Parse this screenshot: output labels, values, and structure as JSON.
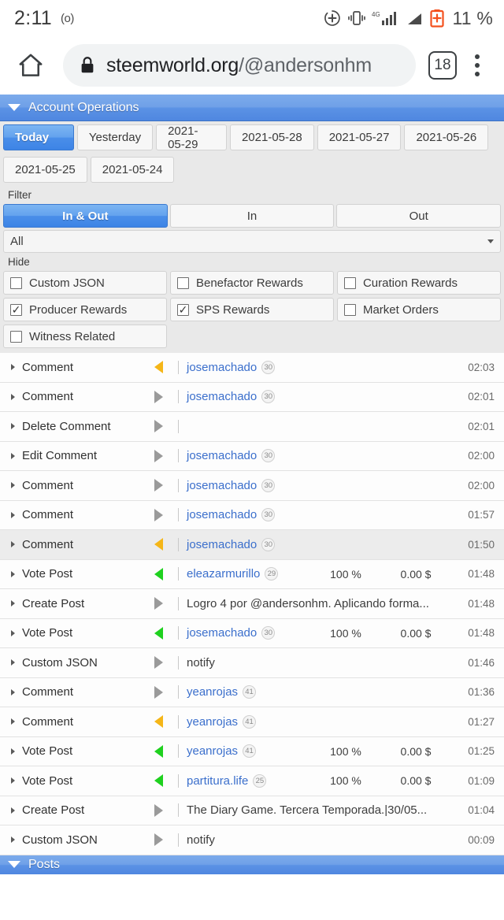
{
  "status_bar": {
    "clock": "2:11",
    "alarm_icon": "alarm-ring-icon",
    "alarm_glyph": "(o)",
    "icons": [
      "data-saver-icon",
      "vibrate-icon",
      "signal-4g-icon",
      "no-sim-icon",
      "battery-charging-icon"
    ],
    "battery_percent": "11 %",
    "network_label": "4G"
  },
  "browser": {
    "home_icon": "home-icon",
    "lock_icon": "lock-icon",
    "url_host": "steemworld.org",
    "url_path": "/@andersonhm",
    "tab_count": "18",
    "menu_icon": "overflow-menu-icon"
  },
  "panel": {
    "title": "Account Operations",
    "caret_icon": "chevron-down-icon"
  },
  "date_tabs": [
    {
      "label": "Today",
      "active": true
    },
    {
      "label": "Yesterday",
      "active": false
    },
    {
      "label": "2021-05-29",
      "active": false
    },
    {
      "label": "2021-05-28",
      "active": false
    },
    {
      "label": "2021-05-27",
      "active": false
    },
    {
      "label": "2021-05-26",
      "active": false
    },
    {
      "label": "2021-05-25",
      "active": false
    },
    {
      "label": "2021-05-24",
      "active": false
    }
  ],
  "filter": {
    "label": "Filter",
    "segments": [
      {
        "label": "In & Out",
        "active": true
      },
      {
        "label": "In",
        "active": false
      },
      {
        "label": "Out",
        "active": false
      }
    ],
    "select_value": "All",
    "select_caret": "caret-down-icon"
  },
  "hide": {
    "label": "Hide",
    "options": [
      {
        "label": "Custom JSON",
        "checked": false
      },
      {
        "label": "Benefactor Rewards",
        "checked": false
      },
      {
        "label": "Curation Rewards",
        "checked": false
      },
      {
        "label": "Producer Rewards",
        "checked": true
      },
      {
        "label": "SPS Rewards",
        "checked": true
      },
      {
        "label": "Market Orders",
        "checked": false
      },
      {
        "label": "Witness Related",
        "checked": false
      }
    ],
    "check_glyph": "✓"
  },
  "operations": [
    {
      "type": "Comment",
      "dir": "in",
      "color": "orange",
      "account": "josemachado",
      "rep": "30",
      "memo": "",
      "pct": "",
      "amount": "",
      "time": "02:03",
      "alt": false
    },
    {
      "type": "Comment",
      "dir": "out",
      "color": "gray",
      "account": "josemachado",
      "rep": "30",
      "memo": "",
      "pct": "",
      "amount": "",
      "time": "02:01",
      "alt": false
    },
    {
      "type": "Delete Comment",
      "dir": "out",
      "color": "gray",
      "account": "",
      "rep": "",
      "memo": "",
      "pct": "",
      "amount": "",
      "time": "02:01",
      "alt": false
    },
    {
      "type": "Edit Comment",
      "dir": "out",
      "color": "gray",
      "account": "josemachado",
      "rep": "30",
      "memo": "",
      "pct": "",
      "amount": "",
      "time": "02:00",
      "alt": false
    },
    {
      "type": "Comment",
      "dir": "out",
      "color": "gray",
      "account": "josemachado",
      "rep": "30",
      "memo": "",
      "pct": "",
      "amount": "",
      "time": "02:00",
      "alt": false
    },
    {
      "type": "Comment",
      "dir": "out",
      "color": "gray",
      "account": "josemachado",
      "rep": "30",
      "memo": "",
      "pct": "",
      "amount": "",
      "time": "01:57",
      "alt": false
    },
    {
      "type": "Comment",
      "dir": "in",
      "color": "orange",
      "account": "josemachado",
      "rep": "30",
      "memo": "",
      "pct": "",
      "amount": "",
      "time": "01:50",
      "alt": true
    },
    {
      "type": "Vote Post",
      "dir": "in",
      "color": "green",
      "account": "eleazarmurillo",
      "rep": "29",
      "memo": "",
      "pct": "100 %",
      "amount": "0.00 $",
      "time": "01:48",
      "alt": false
    },
    {
      "type": "Create Post",
      "dir": "out",
      "color": "gray",
      "account": "",
      "rep": "",
      "memo": "Logro 4 por @andersonhm. Aplicando forma...",
      "pct": "",
      "amount": "",
      "time": "01:48",
      "alt": false
    },
    {
      "type": "Vote Post",
      "dir": "in",
      "color": "green",
      "account": "josemachado",
      "rep": "30",
      "memo": "",
      "pct": "100 %",
      "amount": "0.00 $",
      "time": "01:48",
      "alt": false
    },
    {
      "type": "Custom JSON",
      "dir": "out",
      "color": "gray",
      "account": "",
      "rep": "",
      "memo": "notify",
      "pct": "",
      "amount": "",
      "time": "01:46",
      "alt": false
    },
    {
      "type": "Comment",
      "dir": "out",
      "color": "gray",
      "account": "yeanrojas",
      "rep": "41",
      "memo": "",
      "pct": "",
      "amount": "",
      "time": "01:36",
      "alt": false
    },
    {
      "type": "Comment",
      "dir": "in",
      "color": "orange",
      "account": "yeanrojas",
      "rep": "41",
      "memo": "",
      "pct": "",
      "amount": "",
      "time": "01:27",
      "alt": false
    },
    {
      "type": "Vote Post",
      "dir": "in",
      "color": "green",
      "account": "yeanrojas",
      "rep": "41",
      "memo": "",
      "pct": "100 %",
      "amount": "0.00 $",
      "time": "01:25",
      "alt": false
    },
    {
      "type": "Vote Post",
      "dir": "in",
      "color": "green",
      "account": "partitura.life",
      "rep": "25",
      "memo": "",
      "pct": "100 %",
      "amount": "0.00 $",
      "time": "01:09",
      "alt": false
    },
    {
      "type": "Create Post",
      "dir": "out",
      "color": "gray",
      "account": "",
      "rep": "",
      "memo": "The Diary Game. Tercera Temporada.|30/05...",
      "pct": "",
      "amount": "",
      "time": "01:04",
      "alt": false
    },
    {
      "type": "Custom JSON",
      "dir": "out",
      "color": "gray",
      "account": "",
      "rep": "",
      "memo": "notify",
      "pct": "",
      "amount": "",
      "time": "00:09",
      "alt": false
    }
  ],
  "bottom_panel": {
    "title": "Posts",
    "caret_icon": "chevron-down-icon"
  },
  "colors": {
    "accent_blue": "#4f87e0",
    "link_blue": "#3b6fcc",
    "vote_green": "#1fd11f",
    "incoming_orange": "#f5b618",
    "outgoing_gray": "#9a9a9a",
    "battery_orange": "#f4511e"
  }
}
